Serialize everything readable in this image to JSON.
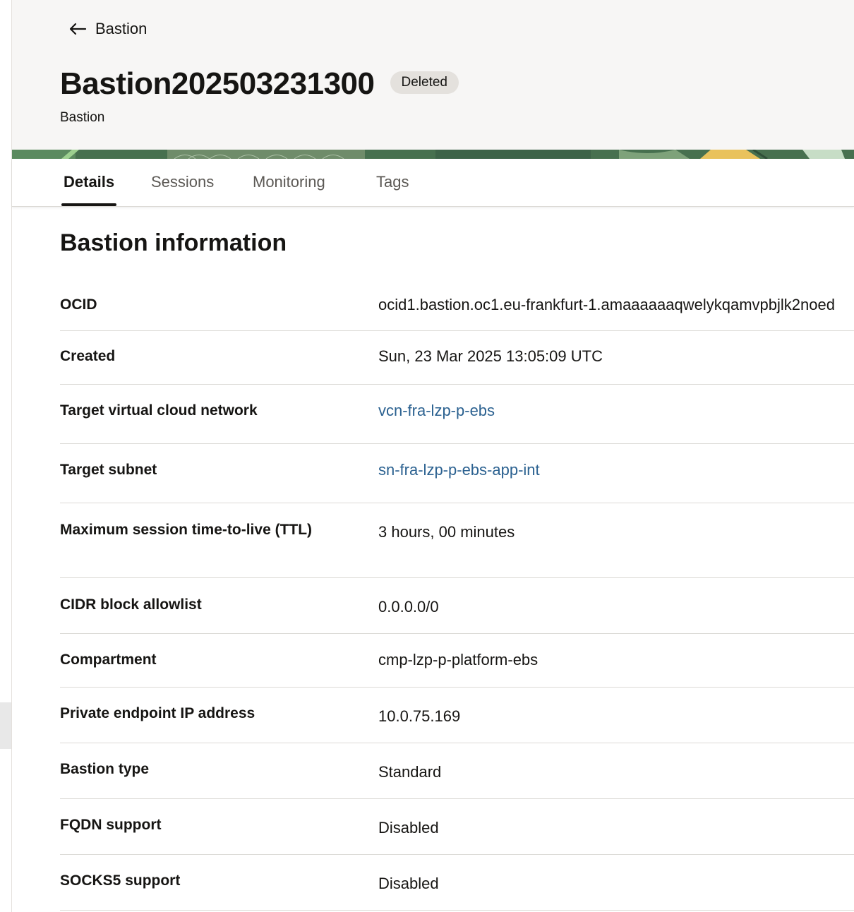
{
  "header": {
    "back_label": "Bastion",
    "title": "Bastion202503231300",
    "status": "Deleted",
    "subtitle": "Bastion"
  },
  "tabs": [
    {
      "label": "Details",
      "active": true
    },
    {
      "label": "Sessions",
      "active": false
    },
    {
      "label": "Monitoring",
      "active": false
    },
    {
      "label": "Tags",
      "active": false
    }
  ],
  "section": {
    "title": "Bastion information"
  },
  "info": [
    {
      "label": "OCID",
      "value": "ocid1.bastion.oc1.eu-frankfurt-1.amaaaaaaqwelykqamvpbjlk2noed",
      "link": false
    },
    {
      "label": "Created",
      "value": "Sun, 23 Mar 2025 13:05:09 UTC",
      "link": false
    },
    {
      "label": "Target virtual cloud network",
      "value": "vcn-fra-lzp-p-ebs",
      "link": true
    },
    {
      "label": "Target subnet",
      "value": "sn-fra-lzp-p-ebs-app-int",
      "link": true
    },
    {
      "label": "Maximum session time-to-live (TTL)",
      "value": "3 hours, 00 minutes",
      "link": false
    },
    {
      "label": "CIDR block allowlist",
      "value": "0.0.0.0/0",
      "link": false
    },
    {
      "label": "Compartment",
      "value": "cmp-lzp-p-platform-ebs",
      "link": false
    },
    {
      "label": "Private endpoint IP address",
      "value": "10.0.75.169",
      "link": false
    },
    {
      "label": "Bastion type",
      "value": "Standard",
      "link": false
    },
    {
      "label": "FQDN support",
      "value": "Disabled",
      "link": false
    },
    {
      "label": "SOCKS5 support",
      "value": "Disabled",
      "link": false
    }
  ],
  "colors": {
    "link": "#2b6190",
    "header_bg": "#f7f6f5",
    "badge_bg": "#e4e1dd"
  },
  "icons": {
    "back": "arrow-left-icon"
  }
}
